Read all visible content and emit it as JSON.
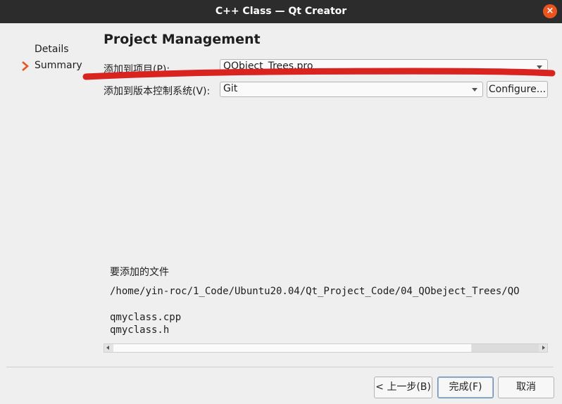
{
  "window": {
    "title": "C++ Class — Qt Creator",
    "close_glyph": "×"
  },
  "steps": [
    {
      "label": "Details"
    },
    {
      "label": "Summary",
      "current": true
    }
  ],
  "page": {
    "heading": "Project Management"
  },
  "form": {
    "add_to_project_label": "添加到项目(P):",
    "project_value": "QObject_Trees.pro",
    "add_to_vcs_label": "添加到版本控制系统(V):",
    "vcs_value": "Git",
    "configure_label": "Configure..."
  },
  "files": {
    "title": "要添加的文件",
    "path": "/home/yin-roc/1_Code/Ubuntu20.04/Qt_Project_Code/04_QObeject_Trees/QO",
    "items": [
      "qmyclass.cpp",
      "qmyclass.h"
    ]
  },
  "footer": {
    "back_label": "< 上一步(B)",
    "finish_label": "完成(F)",
    "cancel_label": "取消"
  },
  "colors": {
    "titlebar": "#2c2c2c",
    "close_button": "#e95420",
    "annotation_red": "#d9231f",
    "step_arrow": "#e95420"
  }
}
